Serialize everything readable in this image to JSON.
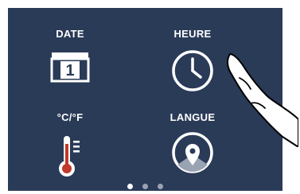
{
  "tiles": {
    "date": {
      "label": "DATE",
      "icon": "calendar-icon",
      "day": "1"
    },
    "heure": {
      "label": "HEURE",
      "icon": "clock-icon"
    },
    "temperature": {
      "label": "°C/°F",
      "icon": "thermometer-icon"
    },
    "langue": {
      "label": "LANGUE",
      "icon": "location-pin-icon"
    }
  },
  "pagination": {
    "pages": 3,
    "active": 1
  },
  "colors": {
    "screen_bg": "#2a3b58",
    "icon_white": "#ffffff",
    "dot_inactive": "#9aa3b1"
  }
}
